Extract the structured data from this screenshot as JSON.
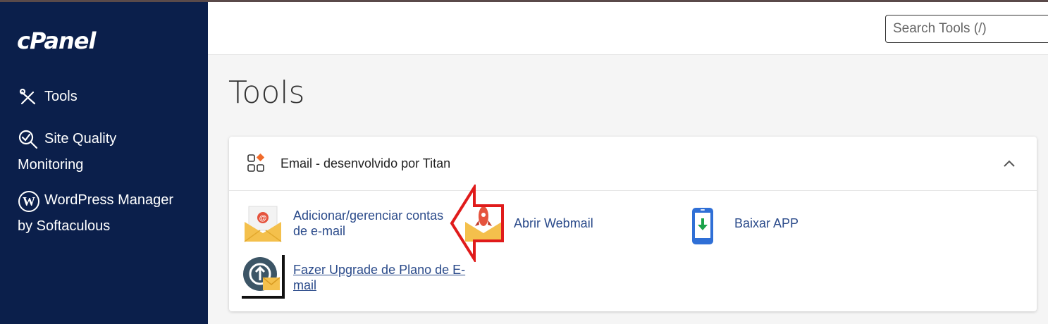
{
  "app": {
    "logo": "cPanel"
  },
  "sidebar": {
    "items": [
      {
        "label": "Tools",
        "icon": "tools-icon"
      },
      {
        "label": "Site Quality",
        "label2": "Monitoring",
        "icon": "magnifier-check-icon"
      },
      {
        "label": "WordPress Manager",
        "label2": "by Softaculous",
        "icon": "wordpress-icon"
      }
    ]
  },
  "header": {
    "search_placeholder": "Search Tools (/)"
  },
  "main": {
    "title": "Tools",
    "group": {
      "title": "Email - desenvolvido por Titan",
      "icon": "apps-grid-icon",
      "items": [
        {
          "label_line1": "Adicionar/gerenciar contas",
          "label_line2": "de e-mail",
          "icon": "envelope-at-icon"
        },
        {
          "label": "Abrir Webmail",
          "icon": "rocket-envelope-icon"
        },
        {
          "label": "Baixar APP",
          "icon": "phone-download-icon"
        },
        {
          "label_line1": "Fazer Upgrade de Plano de E-",
          "label_line2": "mail",
          "icon": "upgrade-envelope-icon"
        }
      ]
    }
  },
  "colors": {
    "sidebar": "#0b1f4b",
    "link": "#2a4a8a",
    "arrow": "#e01b1b"
  }
}
